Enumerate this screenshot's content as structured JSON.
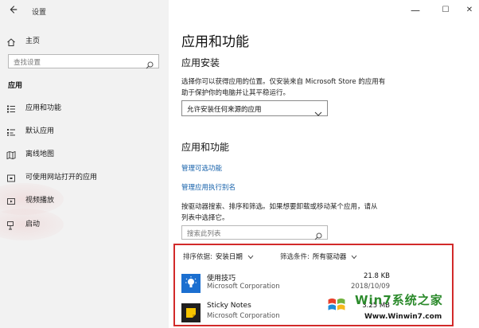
{
  "window": {
    "title": "设置",
    "back_icon": "back-arrow-icon",
    "minimize": "—",
    "maximize": "☐",
    "close": "✕"
  },
  "sidebar": {
    "home_label": "主页",
    "search_placeholder": "查找设置",
    "section_label": "应用",
    "items": [
      {
        "label": "应用和功能",
        "icon": "apps-list-icon"
      },
      {
        "label": "默认应用",
        "icon": "default-apps-icon"
      },
      {
        "label": "离线地图",
        "icon": "offline-maps-icon"
      },
      {
        "label": "可使用网站打开的应用",
        "icon": "apps-for-websites-icon"
      },
      {
        "label": "视频播放",
        "icon": "video-playback-icon"
      },
      {
        "label": "启动",
        "icon": "startup-icon"
      }
    ]
  },
  "main": {
    "title": "应用和功能",
    "install": {
      "heading": "应用安装",
      "desc_line1": "选择你可以获得应用的位置。仅安装来自 Microsoft Store 的应用有",
      "desc_line2": "助于保护你的电脑并让其平稳运行。",
      "dropdown_value": "允许安装任何来源的应用"
    },
    "features": {
      "heading": "应用和功能",
      "link1": "管理可选功能",
      "link2": "管理应用执行别名",
      "desc_line1": "按驱动器搜索、排序和筛选。如果想要卸载或移动某个应用，请从",
      "desc_line2": "列表中选择它。",
      "search_placeholder": "搜索此列表"
    },
    "sort": {
      "label": "排序依据:",
      "value": "安装日期"
    },
    "filter": {
      "label": "筛选条件:",
      "value": "所有驱动器"
    },
    "apps": [
      {
        "name": "使用技巧",
        "publisher": "Microsoft Corporation",
        "size": "21.8 KB",
        "date": "2018/10/09",
        "icon": "tips-lightbulb-icon",
        "color": "#1b6fd0"
      },
      {
        "name": "Sticky Notes",
        "publisher": "Microsoft Corporation",
        "size": "3.25 MB",
        "date": "",
        "icon": "sticky-notes-icon",
        "color": "#1f1f1f"
      }
    ]
  },
  "watermark": {
    "brand": "Win7系统之家",
    "url": "Www.Winwin7.com"
  },
  "colors": {
    "accent_link": "#1460aa",
    "highlight_border": "#d22a2a"
  }
}
